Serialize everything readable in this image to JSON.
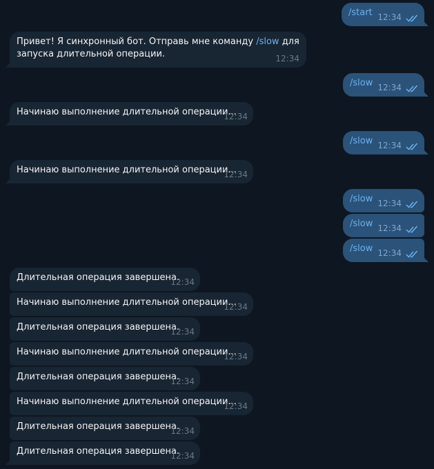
{
  "messages": [
    {
      "dir": "out",
      "text": "/start",
      "time": "12:34",
      "read": true
    },
    {
      "dir": "in",
      "parts": [
        "Привет! Я синхронный бот. Отправь мне команду ",
        "/slow",
        " для",
        "запуска длительной операции."
      ],
      "time": "12:34"
    },
    {
      "dir": "out",
      "text": "/slow",
      "time": "12:34",
      "read": true
    },
    {
      "dir": "in",
      "text": "Начинаю выполнение длительной операции...",
      "time": "12:34"
    },
    {
      "dir": "out",
      "text": "/slow",
      "time": "12:34",
      "read": true
    },
    {
      "dir": "in",
      "text": "Начинаю выполнение длительной операции...",
      "time": "12:34"
    },
    {
      "dir": "out",
      "text": "/slow",
      "time": "12:34",
      "read": true
    },
    {
      "dir": "out",
      "text": "/slow",
      "time": "12:34",
      "read": true
    },
    {
      "dir": "out",
      "text": "/slow",
      "time": "12:34",
      "read": true
    },
    {
      "dir": "in",
      "text": "Длительная операция завершена.",
      "time": "12:34"
    },
    {
      "dir": "in",
      "text": "Начинаю выполнение длительной операции...",
      "time": "12:34"
    },
    {
      "dir": "in",
      "text": "Длительная операция завершена.",
      "time": "12:34"
    },
    {
      "dir": "in",
      "text": "Начинаю выполнение длительной операции...",
      "time": "12:34"
    },
    {
      "dir": "in",
      "text": "Длительная операция завершена.",
      "time": "12:34"
    },
    {
      "dir": "in",
      "text": "Начинаю выполнение длительной операции...",
      "time": "12:34"
    },
    {
      "dir": "in",
      "text": "Длительная операция завершена.",
      "time": "12:34"
    },
    {
      "dir": "in",
      "text": "Длительная операция завершена.",
      "time": "12:34"
    }
  ],
  "colors": {
    "background": "#0e1621",
    "incoming_bubble": "#182533",
    "outgoing_bubble": "#2b5278",
    "command_link": "#6ab3f3",
    "read_check": "#6ab3f3"
  },
  "icons": {
    "read_status": "double-check-icon"
  }
}
